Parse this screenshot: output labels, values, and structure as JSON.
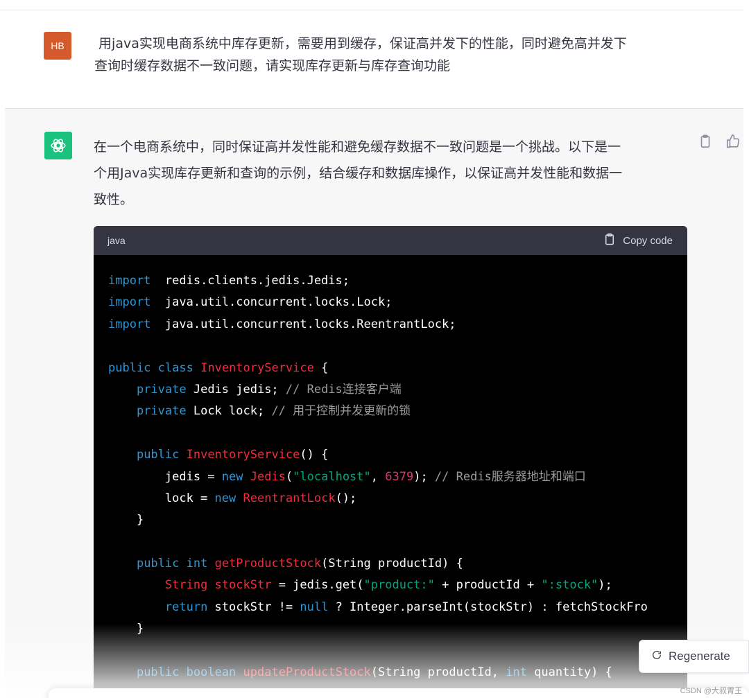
{
  "user_message": {
    "avatar_initials": "HB",
    "text_line1": " 用java实现电商系统中库存更新，需要用到缓存，保证高并发下的性能，同时避免高并发下",
    "text_line2": "查询时缓存数据不一致问题，请实现库存更新与库存查询功能"
  },
  "assistant_message": {
    "line1": "在一个电商系统中，同时保证高并发性能和避免缓存数据不一致问题是一个挑战。以下是一",
    "line2": "个用Java实现库存更新和查询的示例，结合缓存和数据库操作，以保证高并发性能和数据一",
    "line3": "致性。"
  },
  "code_block": {
    "language": "java",
    "copy_label": "Copy code",
    "lines": [
      [
        [
          "kw",
          "import"
        ],
        [
          "",
          "  redis.clients.jedis.Jedis;"
        ]
      ],
      [
        [
          "kw",
          "import"
        ],
        [
          "",
          "  java.util.concurrent.locks.Lock;"
        ]
      ],
      [
        [
          "kw",
          "import"
        ],
        [
          "",
          "  java.util.concurrent.locks.ReentrantLock;"
        ]
      ],
      [],
      [
        [
          "kw",
          "public"
        ],
        [
          "",
          " "
        ],
        [
          "kw",
          "class"
        ],
        [
          "",
          " "
        ],
        [
          "cls",
          "InventoryService"
        ],
        [
          "",
          " {"
        ]
      ],
      [
        [
          "",
          "    "
        ],
        [
          "kw",
          "private"
        ],
        [
          "",
          " Jedis jedis; "
        ],
        [
          "cm",
          "// Redis连接客户端"
        ]
      ],
      [
        [
          "",
          "    "
        ],
        [
          "kw",
          "private"
        ],
        [
          "",
          " Lock lock; "
        ],
        [
          "cm",
          "// 用于控制并发更新的锁"
        ]
      ],
      [],
      [
        [
          "",
          "    "
        ],
        [
          "kw",
          "public"
        ],
        [
          "",
          " "
        ],
        [
          "cls",
          "InventoryService"
        ],
        [
          "",
          "() {"
        ]
      ],
      [
        [
          "",
          "        jedis = "
        ],
        [
          "kw",
          "new"
        ],
        [
          "",
          " "
        ],
        [
          "cls",
          "Jedis"
        ],
        [
          "",
          "("
        ],
        [
          "str",
          "\"localhost\""
        ],
        [
          "",
          ", "
        ],
        [
          "num",
          "6379"
        ],
        [
          "",
          "); "
        ],
        [
          "cm",
          "// Redis服务器地址和端口"
        ]
      ],
      [
        [
          "",
          "        lock = "
        ],
        [
          "kw",
          "new"
        ],
        [
          "",
          " "
        ],
        [
          "cls",
          "ReentrantLock"
        ],
        [
          "",
          "();"
        ]
      ],
      [
        [
          "",
          "    }"
        ]
      ],
      [],
      [
        [
          "",
          "    "
        ],
        [
          "kw",
          "public"
        ],
        [
          "",
          " "
        ],
        [
          "kw",
          "int"
        ],
        [
          "",
          " "
        ],
        [
          "cls",
          "getProductStock"
        ],
        [
          "",
          "(String productId) {"
        ]
      ],
      [
        [
          "",
          "        "
        ],
        [
          "cls",
          "String"
        ],
        [
          "",
          " "
        ],
        [
          "cls",
          "stockStr"
        ],
        [
          "",
          " = jedis.get("
        ],
        [
          "str",
          "\"product:\""
        ],
        [
          "",
          " + productId + "
        ],
        [
          "str",
          "\":stock\""
        ],
        [
          "",
          ");"
        ]
      ],
      [
        [
          "",
          "        "
        ],
        [
          "kw",
          "return"
        ],
        [
          "",
          " stockStr != "
        ],
        [
          "kw",
          "null"
        ],
        [
          "",
          " ? Integer.parseInt(stockStr) : fetchStockFro"
        ]
      ],
      [
        [
          "",
          "    }"
        ]
      ],
      [],
      [
        [
          "",
          "    "
        ],
        [
          "kw",
          "public"
        ],
        [
          "",
          " "
        ],
        [
          "kw",
          "boolean"
        ],
        [
          "",
          " "
        ],
        [
          "cls",
          "updateProductStock"
        ],
        [
          "",
          "(String productId, "
        ],
        [
          "kw",
          "int"
        ],
        [
          "",
          " quantity) {"
        ]
      ]
    ]
  },
  "regenerate_label": "Regenerate",
  "watermark": "CSDN @大叔胃王",
  "icons": {
    "gpt_logo": "openai-logo-icon",
    "copy": "clipboard-icon",
    "like": "thumbs-up-icon",
    "regenerate": "refresh-icon"
  },
  "colors": {
    "user_avatar": "#d4592b",
    "gpt_avatar": "#19c37d",
    "code_header": "#343541",
    "code_bg": "#000000",
    "keyword": "#2e95d3",
    "class_name": "#f22c3d",
    "string": "#00a67d",
    "number": "#df3079",
    "comment": "#9b9b9b"
  }
}
